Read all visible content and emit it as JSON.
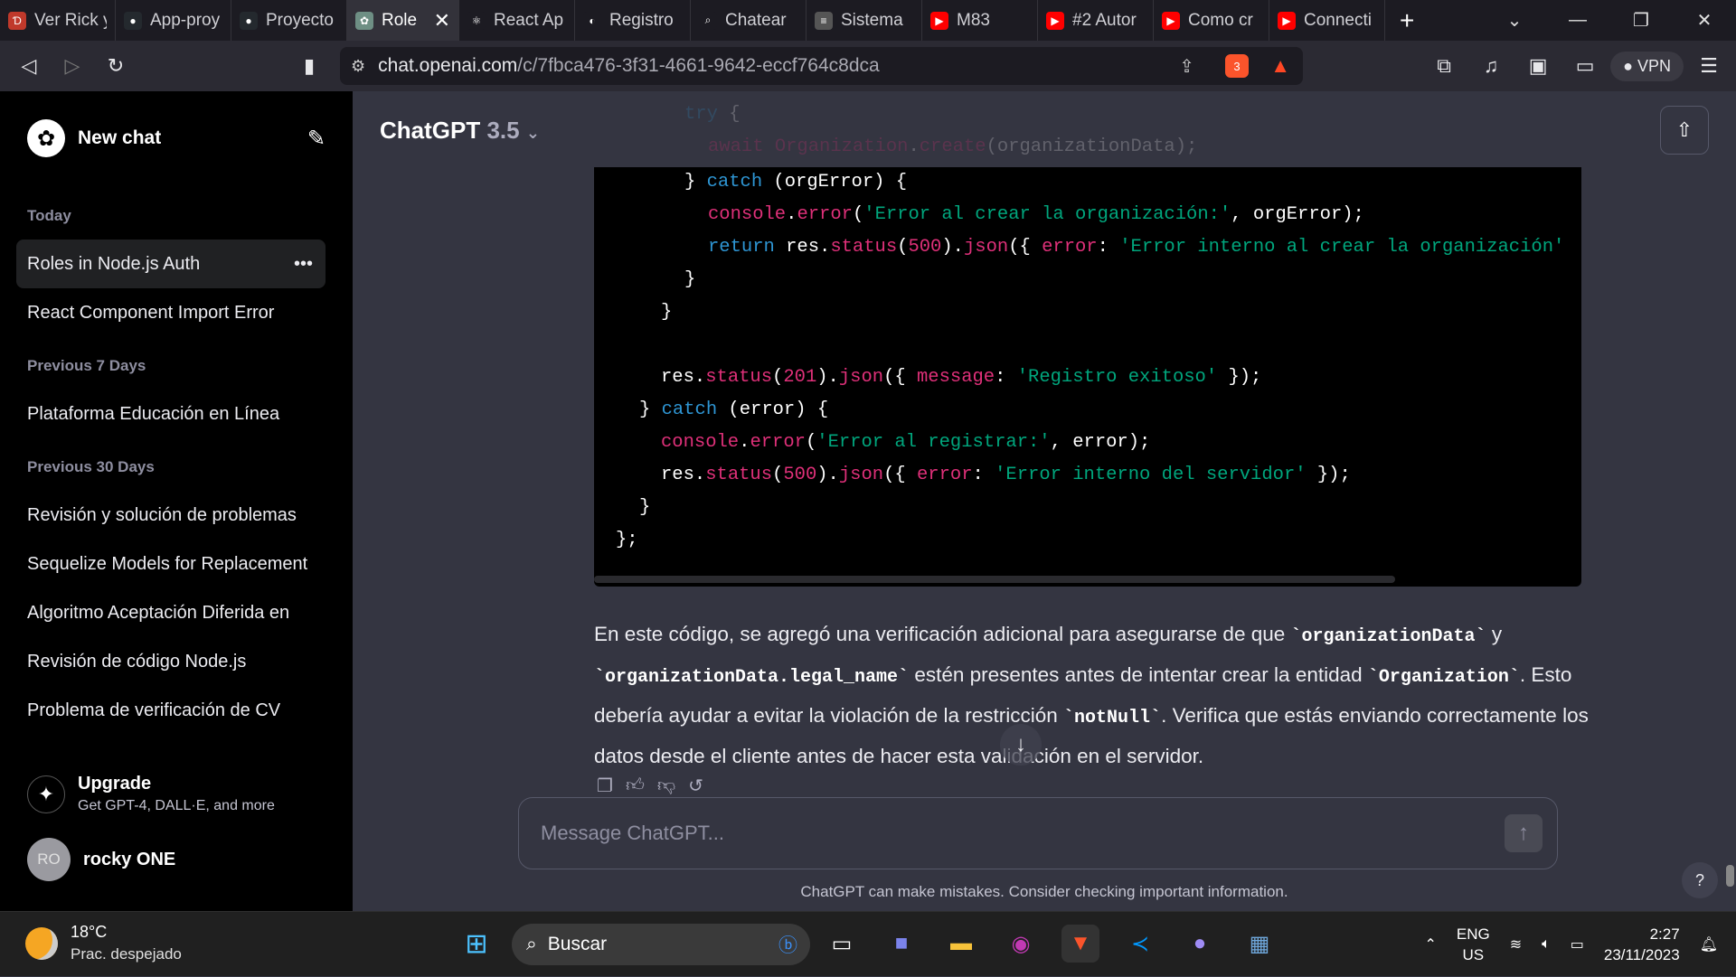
{
  "tabs": [
    {
      "title": "Ver Rick y",
      "icon": "dl-icon",
      "color": "#c0392b"
    },
    {
      "title": "App-proy",
      "icon": "github-icon",
      "color": "#24292e"
    },
    {
      "title": "Proyecto",
      "icon": "github-icon",
      "color": "#24292e"
    },
    {
      "title": "Role",
      "icon": "openai-icon",
      "color": "#6e8f84",
      "active": true
    },
    {
      "title": "React Ap",
      "icon": "react-icon",
      "color": "#1c1b22"
    },
    {
      "title": "Registro",
      "icon": "record-icon",
      "color": "#1c1b22"
    },
    {
      "title": "Chatear",
      "icon": "search-icon",
      "color": "#1c1b22"
    },
    {
      "title": "Sistema",
      "icon": "site-icon",
      "color": "#555"
    },
    {
      "title": "M83",
      "icon": "youtube-icon",
      "color": "#ff0000"
    },
    {
      "title": "#2 Autor",
      "icon": "youtube-icon",
      "color": "#ff0000"
    },
    {
      "title": "Como cr",
      "icon": "youtube-icon",
      "color": "#ff0000"
    },
    {
      "title": "Connecti",
      "icon": "youtube-icon",
      "color": "#ff0000"
    }
  ],
  "browser": {
    "url_host": "chat.openai.com",
    "url_path": "/c/7fbca476-3f31-4661-9642-eccf764c8dca",
    "shield_badge": "3",
    "vpn_label": "VPN"
  },
  "sidebar": {
    "new_chat": "New chat",
    "sections": [
      {
        "label": "Today",
        "items": [
          "Roles in Node.js Auth",
          "React Component Import Error"
        ]
      },
      {
        "label": "Previous 7 Days",
        "items": [
          "Plataforma Educación en Línea"
        ]
      },
      {
        "label": "Previous 30 Days",
        "items": [
          "Revisión y solución de problemas",
          "Sequelize Models for Replacement",
          "Algoritmo Aceptación Diferida en",
          "Revisión de código Node.js",
          "Problema de verificación de CV"
        ]
      }
    ],
    "upgrade_title": "Upgrade",
    "upgrade_sub": "Get GPT-4, DALL·E, and more",
    "user_initials": "RO",
    "user_name": "rocky ONE"
  },
  "main": {
    "model_name": "ChatGPT",
    "model_version": "3.5",
    "code_faded": [
      [
        [
          "k",
          "try"
        ],
        [
          "w",
          " {"
        ]
      ],
      [
        [
          "r",
          "await "
        ],
        [
          "r",
          "Organization"
        ],
        [
          "w",
          "."
        ],
        [
          "r",
          "create"
        ],
        [
          "w",
          "(organizationData);"
        ]
      ]
    ],
    "code": [
      [
        [
          "w",
          "} "
        ],
        [
          "k",
          "catch"
        ],
        [
          "w",
          " (orgError) {"
        ]
      ],
      [
        [
          "r",
          "console"
        ],
        [
          "w",
          "."
        ],
        [
          "r",
          "error"
        ],
        [
          "w",
          "("
        ],
        [
          "s",
          "'Error al crear la organización:'"
        ],
        [
          "w",
          ", orgError);"
        ]
      ],
      [
        [
          "k",
          "return"
        ],
        [
          "w",
          " res."
        ],
        [
          "r",
          "status"
        ],
        [
          "w",
          "("
        ],
        [
          "r",
          "500"
        ],
        [
          "w",
          ")."
        ],
        [
          "r",
          "json"
        ],
        [
          "w",
          "({ "
        ],
        [
          "r",
          "error"
        ],
        [
          "w",
          ": "
        ],
        [
          "s",
          "'Error interno al crear la organización'"
        ]
      ],
      [
        [
          "w",
          "}"
        ]
      ],
      [
        [
          "w",
          "}"
        ]
      ],
      [
        [
          "w",
          ""
        ]
      ],
      [
        [
          "w",
          "res."
        ],
        [
          "r",
          "status"
        ],
        [
          "w",
          "("
        ],
        [
          "r",
          "201"
        ],
        [
          "w",
          ")."
        ],
        [
          "r",
          "json"
        ],
        [
          "w",
          "({ "
        ],
        [
          "r",
          "message"
        ],
        [
          "w",
          ": "
        ],
        [
          "s",
          "'Registro exitoso'"
        ],
        [
          "w",
          " });"
        ]
      ],
      [
        [
          "w",
          "} "
        ],
        [
          "k",
          "catch"
        ],
        [
          "w",
          " (error) {"
        ]
      ],
      [
        [
          "r",
          "console"
        ],
        [
          "w",
          "."
        ],
        [
          "r",
          "error"
        ],
        [
          "w",
          "("
        ],
        [
          "s",
          "'Error al registrar:'"
        ],
        [
          "w",
          ", error);"
        ]
      ],
      [
        [
          "w",
          "res."
        ],
        [
          "r",
          "status"
        ],
        [
          "w",
          "("
        ],
        [
          "r",
          "500"
        ],
        [
          "w",
          ")."
        ],
        [
          "r",
          "json"
        ],
        [
          "w",
          "({ "
        ],
        [
          "r",
          "error"
        ],
        [
          "w",
          ": "
        ],
        [
          "s",
          "'Error interno del servidor'"
        ],
        [
          "w",
          " });"
        ]
      ],
      [
        [
          "w",
          "}"
        ]
      ],
      [
        [
          "w",
          "};"
        ]
      ]
    ],
    "paragraph": [
      [
        "t",
        "En este código, se agregó una verificación adicional para asegurarse de que "
      ],
      [
        "c",
        "`organizationData`"
      ],
      [
        "t",
        " y "
      ],
      [
        "c",
        "`organizationData.legal_name`"
      ],
      [
        "t",
        " estén presentes antes de intentar crear la entidad "
      ],
      [
        "c",
        "`Organization`"
      ],
      [
        "t",
        ". Esto debería ayudar a evitar la violación de la restricción "
      ],
      [
        "c",
        "`notNull`"
      ],
      [
        "t",
        ". Verifica que estás enviando correctamente los datos desde el cliente antes de hacer esta validación en el servidor."
      ]
    ],
    "input_placeholder": "Message ChatGPT...",
    "disclaimer": "ChatGPT can make mistakes. Consider checking important information.",
    "help_label": "?"
  },
  "taskbar": {
    "temp": "18°C",
    "weather": "Prac. despejado",
    "search_label": "Buscar",
    "lang_1": "ENG",
    "lang_2": "US",
    "time": "2:27",
    "date": "23/11/2023"
  }
}
